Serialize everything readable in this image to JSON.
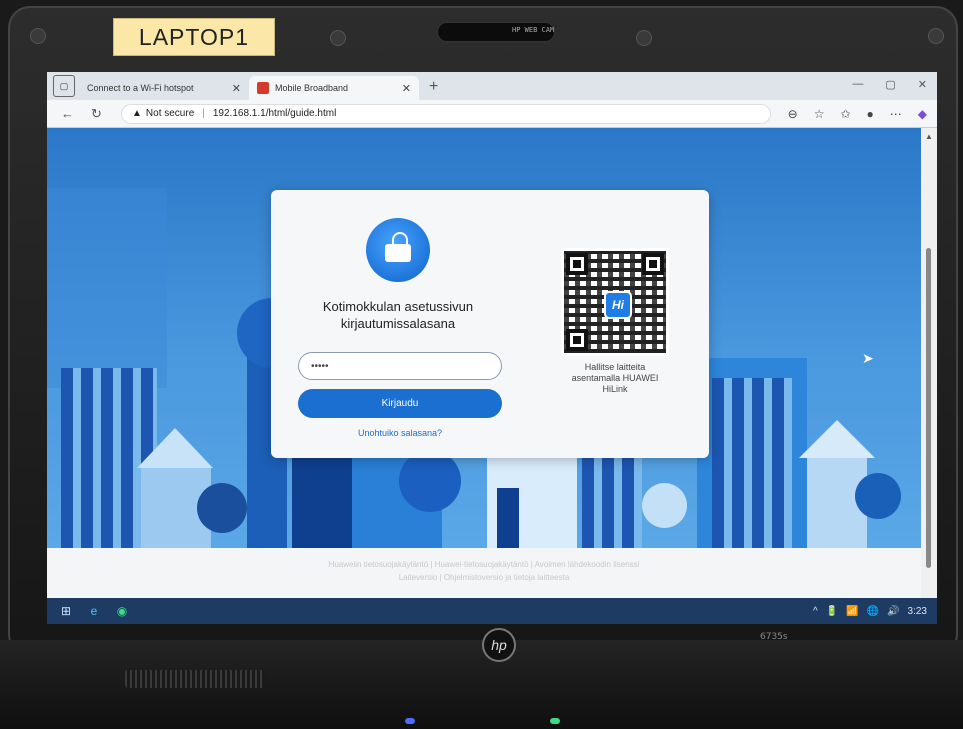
{
  "sticker": {
    "label": "LAPTOP1"
  },
  "bezel": {
    "webcam_text": "HP WEB CAM"
  },
  "browser": {
    "tabs": [
      {
        "label": "Connect to a Wi-Fi hotspot",
        "active": false
      },
      {
        "label": "Mobile Broadband",
        "active": true
      }
    ],
    "new_tab": "+",
    "window_controls": [
      "—",
      "▢",
      "✕"
    ],
    "security_label": "Not secure",
    "url": "192.168.1.1/html/guide.html"
  },
  "login": {
    "title_line1": "Kotimokkulan asetussivun",
    "title_line2": "kirjautumissalasana",
    "password_value": "•••••",
    "login_button": "Kirjaudu",
    "forgot_link": "Unohtuiko salasana?"
  },
  "qr": {
    "badge": "Hi",
    "caption_line1": "Hallitse laitteita",
    "caption_line2": "asentamalla HUAWEI",
    "caption_line3": "HiLink"
  },
  "footer": {
    "row1": "Huaweiin tietosuojakäytäntö  |  Huawei-tietosuojakäytäntö  |  Avoimen lähdekoodin lisenssi",
    "row2": "Laiteversio  |  Ohjelmistoversio ja tietoja laitteesta"
  },
  "taskbar": {
    "clock": "3:23",
    "tray": [
      "^",
      "🔋",
      "📶",
      "🌐",
      "🔊"
    ]
  },
  "laptop": {
    "brand": "hp",
    "model": "6735s"
  },
  "colors": {
    "primary_blue": "#1a6fd1",
    "sky": "#2a78c7",
    "taskbar": "#1d3b63"
  }
}
